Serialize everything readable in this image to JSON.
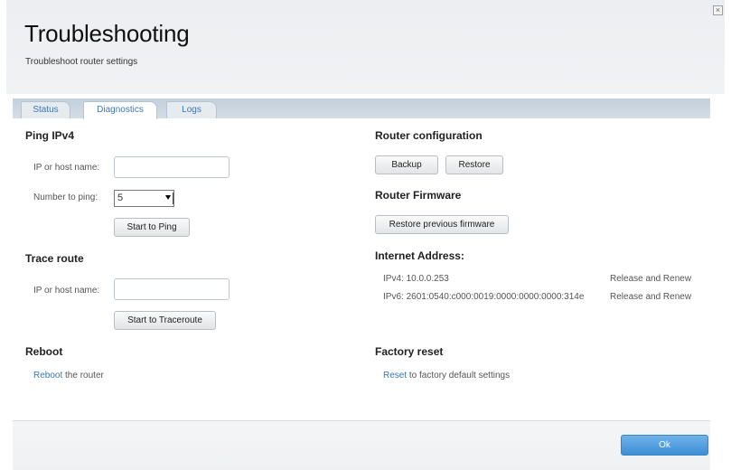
{
  "header": {
    "title": "Troubleshooting",
    "subtitle": "Troubleshoot router settings",
    "close_label": "×"
  },
  "tabs": [
    {
      "label": "Status",
      "active": false
    },
    {
      "label": "Diagnostics",
      "active": true
    },
    {
      "label": "Logs",
      "active": false
    }
  ],
  "ping": {
    "heading": "Ping IPv4",
    "host_label": "IP or host name:",
    "host_value": "",
    "count_label": "Number to ping:",
    "count_value": "5",
    "start_label": "Start to Ping"
  },
  "trace": {
    "heading": "Trace route",
    "host_label": "IP or host name:",
    "host_value": "",
    "start_label": "Start to Traceroute"
  },
  "reboot": {
    "heading": "Reboot",
    "link": "Reboot",
    "text": " the router"
  },
  "router_config": {
    "heading": "Router configuration",
    "backup_label": "Backup",
    "restore_label": "Restore"
  },
  "firmware": {
    "heading": "Router Firmware",
    "restore_prev_label": "Restore previous firmware"
  },
  "internet": {
    "heading": "Internet Address:",
    "ipv4": "IPv4: 10.0.0.253",
    "ipv6": "IPv6: 2601:0540:c000:0019:0000:0000:0000:314e",
    "release_renew_v4": "Release and Renew",
    "release_renew_v6": "Release and Renew"
  },
  "factory": {
    "heading": "Factory reset",
    "link": "Reset",
    "text": " to factory default settings"
  },
  "footer": {
    "ok_label": "Ok"
  },
  "colors": {
    "link": "#3a77b5",
    "ok_button": "#4a9ae0"
  }
}
